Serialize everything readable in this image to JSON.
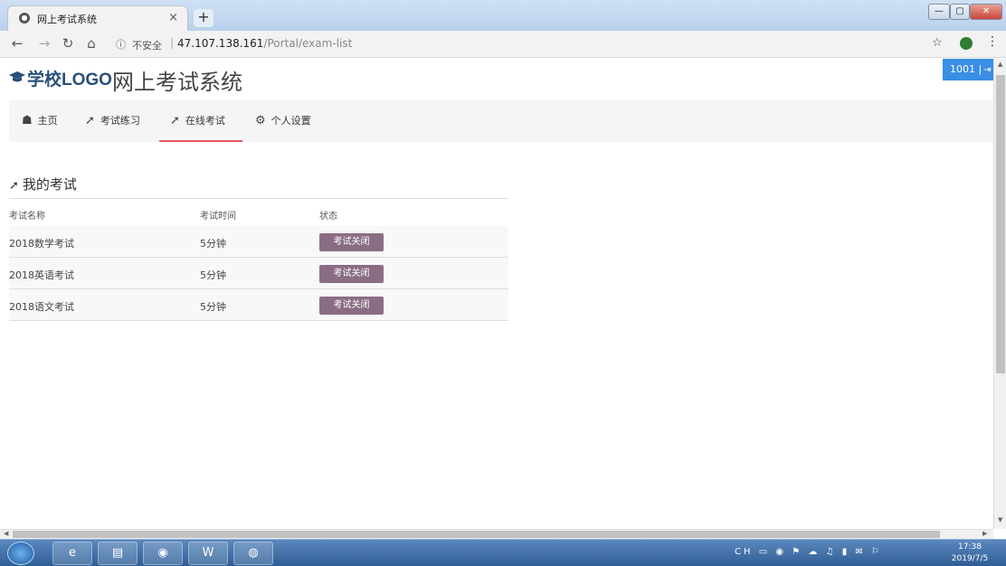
{
  "browser": {
    "tab_title": "网上考试系统",
    "tab_close": "×",
    "new_tab": "+",
    "address": {
      "security_label": "不安全",
      "host": "47.107.138.161",
      "path": "/Portal/exam-list"
    }
  },
  "header": {
    "logo_text": "学校LOGO",
    "site_title": "网上考试系统",
    "user_id": "1001"
  },
  "nav": {
    "items": [
      {
        "label": "主页",
        "icon": "home-icon"
      },
      {
        "label": "考试练习",
        "icon": "paper-plane-icon"
      },
      {
        "label": "在线考试",
        "icon": "paper-plane-icon",
        "active": true
      },
      {
        "label": "个人设置",
        "icon": "gears-icon"
      }
    ]
  },
  "exams": {
    "section_title": "我的考试",
    "columns": [
      "考试名称",
      "考试时间",
      "状态"
    ],
    "rows": [
      {
        "name": "2018数学考试",
        "duration": "5分钟",
        "status": "考试关闭"
      },
      {
        "name": "2018英语考试",
        "duration": "5分钟",
        "status": "考试关闭"
      },
      {
        "name": "2018语文考试",
        "duration": "5分钟",
        "status": "考试关闭"
      }
    ]
  },
  "taskbar": {
    "tray_lang": "CH",
    "time": "17:38",
    "date": "2019/7/5"
  },
  "colors": {
    "accent": "#3a8ee6",
    "active_underline": "#e45a5a",
    "status_button": "#8a6d84"
  }
}
